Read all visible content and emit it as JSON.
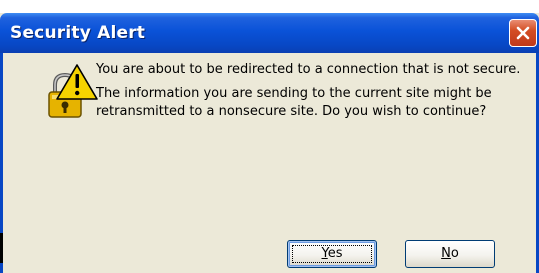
{
  "dialog": {
    "title": "Security Alert",
    "message_line_1": "You are about to be redirected to a connection that is not secure.",
    "message_line_2": "The information you are sending to the current site might be retransmitted to a nonsecure site. Do you wish to continue?",
    "icon": "security-warning-lock-icon"
  },
  "buttons": {
    "yes": {
      "accelerator": "Y",
      "rest": "es"
    },
    "no": {
      "accelerator": "N",
      "rest": "o"
    }
  },
  "colors": {
    "titlebar": "#0a52d8",
    "dialog_bg": "#ece9d8",
    "close_button": "#d44e24",
    "button_border": "#003c74"
  }
}
